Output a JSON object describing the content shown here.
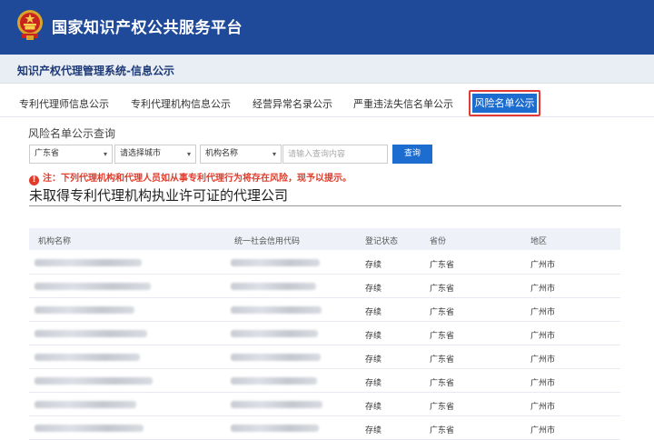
{
  "header": {
    "site_title": "国家知识产权公共服务平台"
  },
  "subheader": {
    "title": "知识产权代理管理系统-信息公示"
  },
  "tabs": [
    {
      "label": "专利代理师信息公示",
      "active": false
    },
    {
      "label": "专利代理机构信息公示",
      "active": false
    },
    {
      "label": "经营异常名录公示",
      "active": false
    },
    {
      "label": "严重违法失信名单公示",
      "active": false
    },
    {
      "label": "风险名单公示",
      "active": true
    }
  ],
  "query": {
    "title": "风险名单公示查询",
    "province_select": "广东省",
    "city_select": "请选择城市",
    "field_select": "机构名称",
    "search_placeholder": "请输入查询内容",
    "search_button": "查询"
  },
  "notice": {
    "text": "注：下列代理机构和代理人员如从事专利代理行为将存在风险，现予以提示。"
  },
  "section": {
    "title": "未取得专利代理机构执业许可证的代理公司"
  },
  "table": {
    "columns": [
      "机构名称",
      "统一社会信用代码",
      "登记状态",
      "省份",
      "地区"
    ],
    "rows": [
      {
        "status": "存续",
        "province": "广东省",
        "region": "广州市"
      },
      {
        "status": "存续",
        "province": "广东省",
        "region": "广州市"
      },
      {
        "status": "存续",
        "province": "广东省",
        "region": "广州市"
      },
      {
        "status": "存续",
        "province": "广东省",
        "region": "广州市"
      },
      {
        "status": "存续",
        "province": "广东省",
        "region": "广州市"
      },
      {
        "status": "存续",
        "province": "广东省",
        "region": "广州市"
      },
      {
        "status": "存续",
        "province": "广东省",
        "region": "广州市"
      },
      {
        "status": "存续",
        "province": "广东省",
        "region": "广州市"
      }
    ]
  },
  "icons": {
    "emblem": "national-emblem-icon",
    "notice": "exclamation-circle-icon",
    "dropdown": "chevron-down-icon"
  },
  "colors": {
    "header_bg": "#1f4a99",
    "active_tab": "#1d6dd0",
    "active_tab_border": "#e23b36",
    "notice_red": "#e23b2a"
  }
}
